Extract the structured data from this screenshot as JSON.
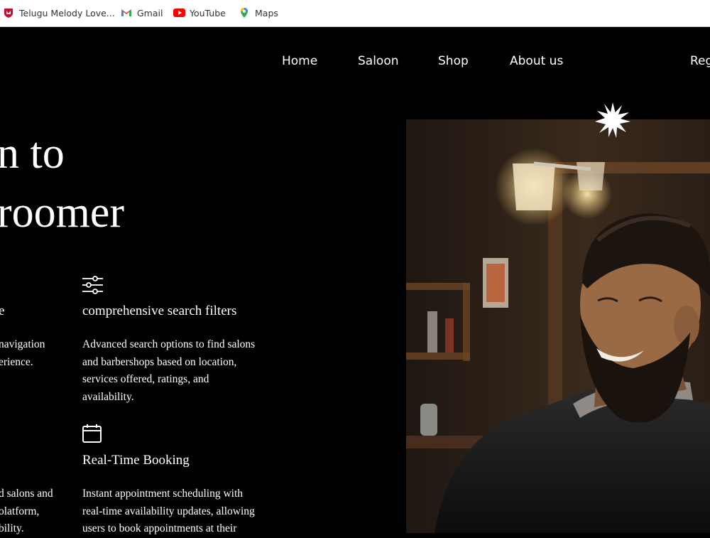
{
  "bookmarks": [
    {
      "label": "Telugu Melody Love...",
      "icon": "mcafee-shield-icon",
      "color": "#c8102e"
    },
    {
      "label": "Gmail",
      "icon": "gmail-icon",
      "color": "#ea4335"
    },
    {
      "label": "YouTube",
      "icon": "youtube-icon",
      "color": "#ff0000"
    },
    {
      "label": "Maps",
      "icon": "maps-pin-icon",
      "color": "#34a853"
    }
  ],
  "nav": {
    "home": "Home",
    "saloon": "Saloon",
    "shop": "Shop",
    "about": "About us",
    "register": "Reg"
  },
  "hero": {
    "line1": "n to",
    "line2": "roomer"
  },
  "features": {
    "left_title": "e",
    "left_text_1": [
      " navigation",
      "erience."
    ],
    "left_text_2": [
      "d salons and",
      "olatform,",
      "bility."
    ],
    "search_title": "comprehensive search filters",
    "search_text": [
      "Advanced search options to find salons",
      "and barbershops based on location,",
      "services offered, ratings, and",
      "availability."
    ],
    "booking_title": "Real-Time Booking",
    "booking_text": [
      "Instant appointment scheduling with",
      "real-time availability updates, allowing",
      "users to book appointments at their"
    ]
  },
  "colors": {
    "background": "#000000",
    "text": "#ffffff",
    "bookmark_bar": "#ffffff"
  }
}
